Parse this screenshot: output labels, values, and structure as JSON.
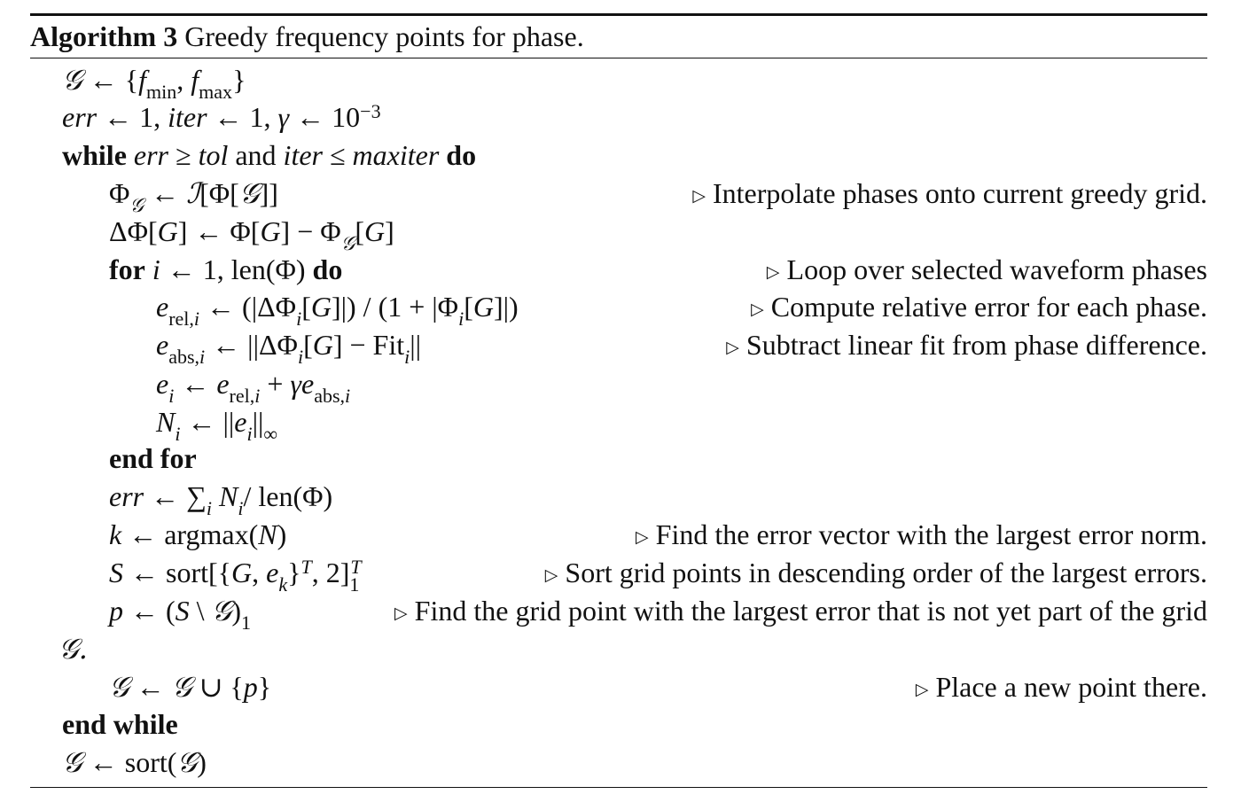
{
  "caption": {
    "label": "Algorithm 3",
    "title": "Greedy frequency points for phase."
  },
  "keywords": {
    "while": "while",
    "and": "and",
    "do": "do",
    "for": "for",
    "end_for": "end for",
    "end_while": "end while"
  },
  "comments": {
    "interpolate": "Interpolate phases onto current greedy grid.",
    "loop": "Loop over selected waveform phases",
    "relative": "Compute relative error for each phase.",
    "subtract": "Subtract linear fit from phase difference.",
    "find_max": "Find the error vector with the largest error norm.",
    "sort": "Sort grid points in descending order of the largest errors.",
    "find_point": "Find the grid point with the largest error that is not yet part of the grid",
    "find_point_cont": "𝒢.",
    "place": "Place a new point there."
  }
}
